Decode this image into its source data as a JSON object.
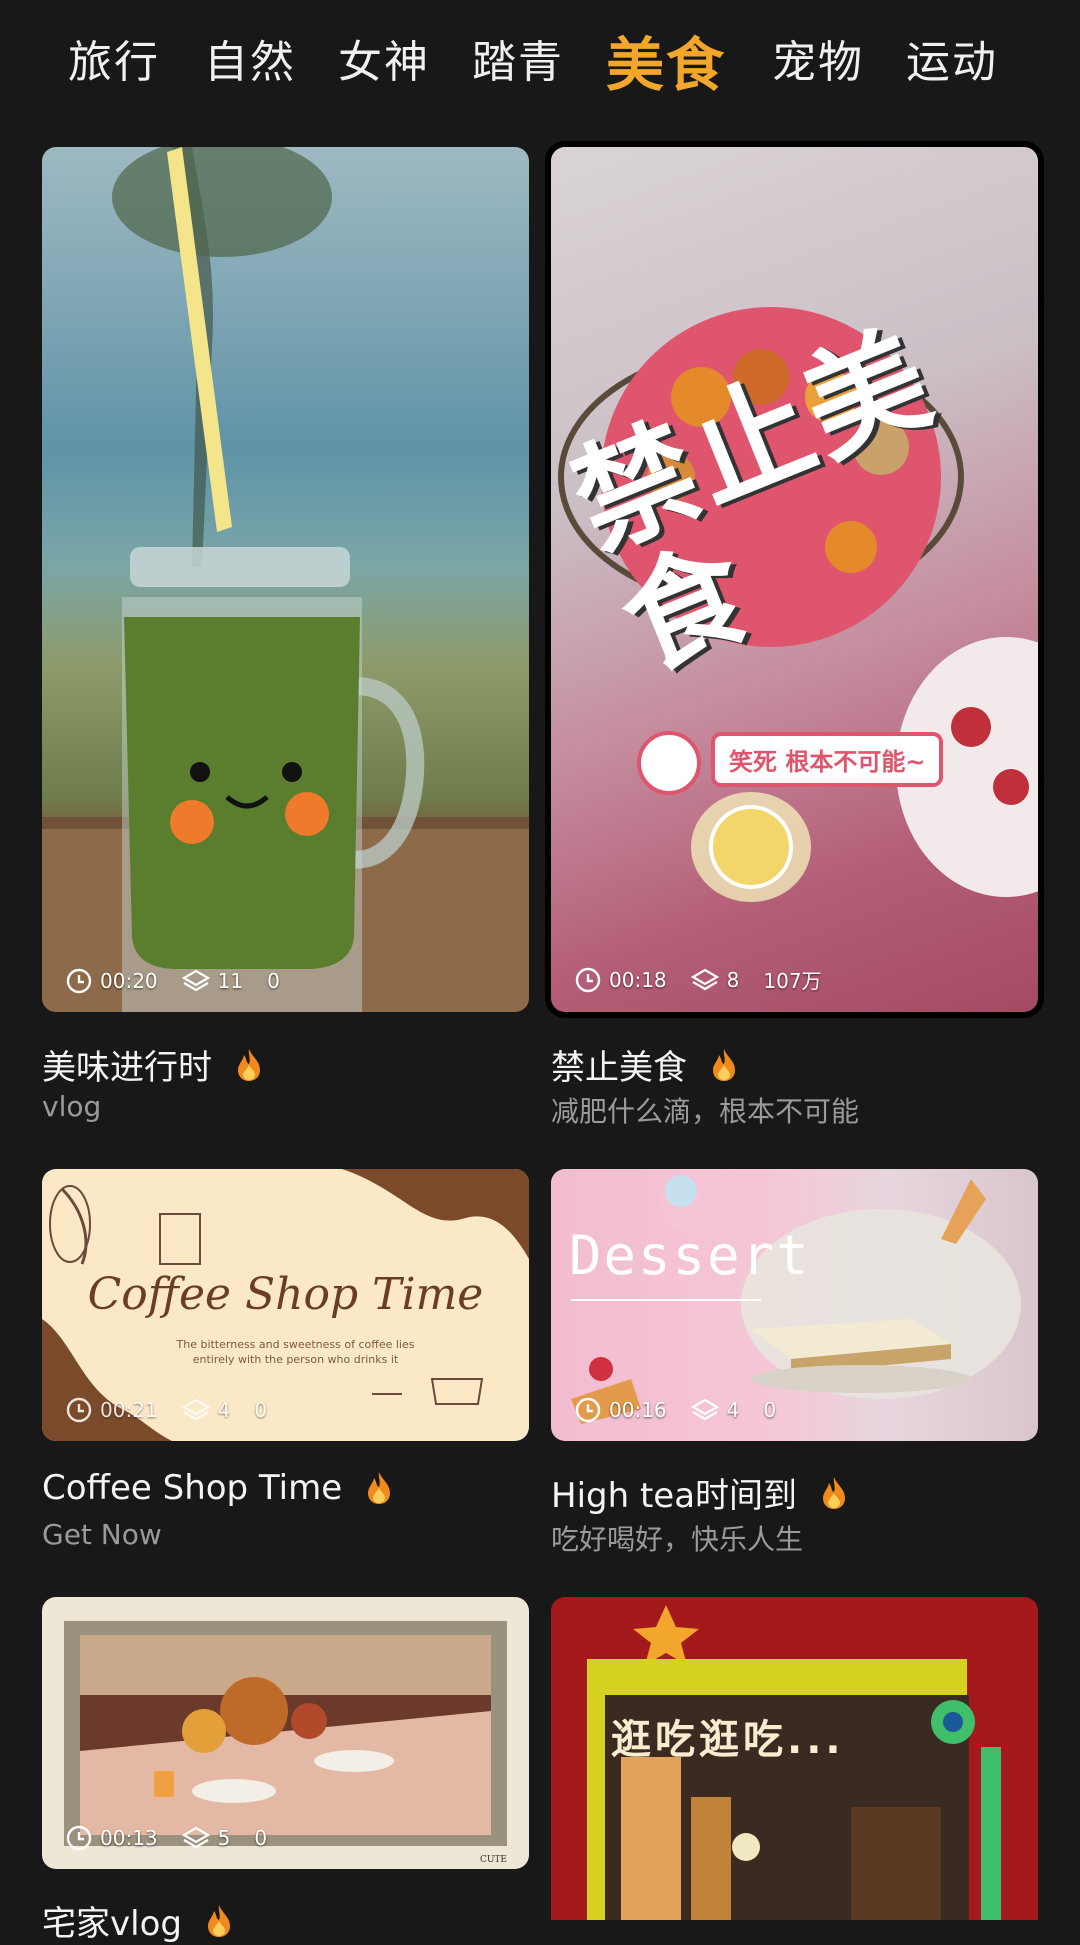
{
  "tabs": [
    "旅行",
    "自然",
    "女神",
    "踏青",
    "美食",
    "宠物",
    "运动"
  ],
  "active_tab_index": 4,
  "colors": {
    "accent": "#f2a62b",
    "background": "#181818"
  },
  "cards": [
    {
      "title": "美味进行时",
      "subtitle": "vlog",
      "duration": "00:20",
      "layers": "11",
      "uses": "0",
      "hot": true
    },
    {
      "title": "禁止美食",
      "subtitle": "减肥什么滴，根本不可能",
      "duration": "00:18",
      "layers": "8",
      "uses": "107万",
      "hot": true,
      "overlay_text": "禁止美食",
      "bubble_text": "笑死 根本不可能~"
    },
    {
      "title": "Coffee Shop Time",
      "subtitle": "Get Now",
      "duration": "00:21",
      "layers": "4",
      "uses": "0",
      "hot": true,
      "overlay_text": "Coffee Shop Time",
      "overlay_sub": "The bitterness and sweetness of coffee lies entirely with the person who drinks it"
    },
    {
      "title": "High tea时间到",
      "subtitle": "吃好喝好，快乐人生",
      "duration": "00:16",
      "layers": "4",
      "uses": "0",
      "hot": true,
      "overlay_text": "Dessert"
    },
    {
      "title": "宅家vlog",
      "subtitle": "",
      "duration": "00:13",
      "layers": "5",
      "uses": "0",
      "hot": true,
      "overlay_small": "CUTE"
    },
    {
      "title": "",
      "subtitle": "",
      "duration": "",
      "layers": "",
      "uses": "",
      "hot": false,
      "overlay_text": "逛吃逛吃..."
    }
  ]
}
